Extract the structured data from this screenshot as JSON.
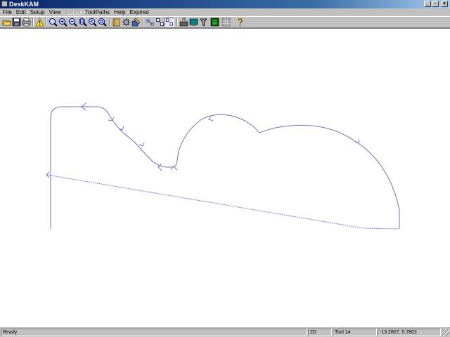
{
  "window": {
    "title": "DeskKAM"
  },
  "menu": {
    "items": [
      {
        "label": "File",
        "enabled": true
      },
      {
        "label": "Edit",
        "enabled": true
      },
      {
        "label": "Setup",
        "enabled": true
      },
      {
        "label": "View",
        "enabled": true
      },
      {
        "label": "Select",
        "enabled": false
      },
      {
        "label": "ToolPaths",
        "enabled": true
      },
      {
        "label": "Help",
        "enabled": true
      },
      {
        "label": "Expired",
        "enabled": true
      }
    ]
  },
  "toolbar": {
    "icons": [
      "open-folder-icon",
      "save-icon",
      "print-icon",
      "warning-icon",
      "zoom-all-icon",
      "zoom-in-icon",
      "zoom-out-icon",
      "zoom-window-icon",
      "zoom-previous-icon",
      "zoom-redraw-icon",
      "tool-library-icon",
      "machine-setup-icon",
      "toolpath-edit-icon",
      "node-select-icon",
      "node-connect-icon",
      "node-break-icon",
      "simulate-icon",
      "display-options-icon",
      "post-process-icon",
      "layer-icon",
      "help-icon"
    ]
  },
  "colors": {
    "toolpath": "#7070c8",
    "rapid": "#8080d0",
    "titlebar": "#08246b"
  },
  "status": {
    "message": "Ready",
    "mode": "2D",
    "tool": "Tool 14",
    "coords": "-13.2807, 0.7802"
  }
}
